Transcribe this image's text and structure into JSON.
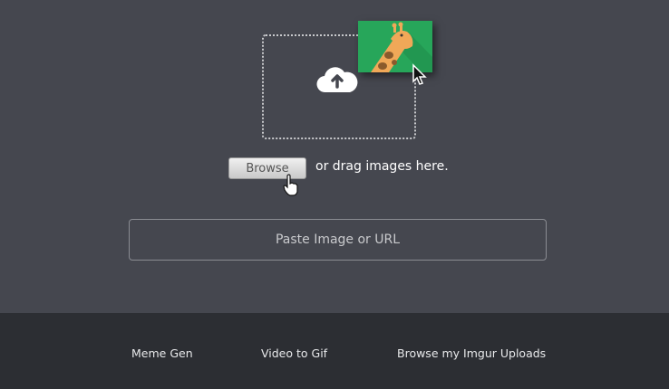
{
  "upload": {
    "icon": "cloud-upload-icon",
    "dragged_thumbnail": "giraffe-image",
    "browse_label": "Browse",
    "drag_text": "or drag images here."
  },
  "url_input": {
    "placeholder": "Paste Image or URL"
  },
  "footer": {
    "links": [
      {
        "label": "Meme Gen"
      },
      {
        "label": "Video to Gif"
      },
      {
        "label": "Browse my Imgur Uploads"
      }
    ]
  },
  "colors": {
    "background": "#45474f",
    "footer": "#2c2e33",
    "thumbnail": "#27a65a"
  }
}
